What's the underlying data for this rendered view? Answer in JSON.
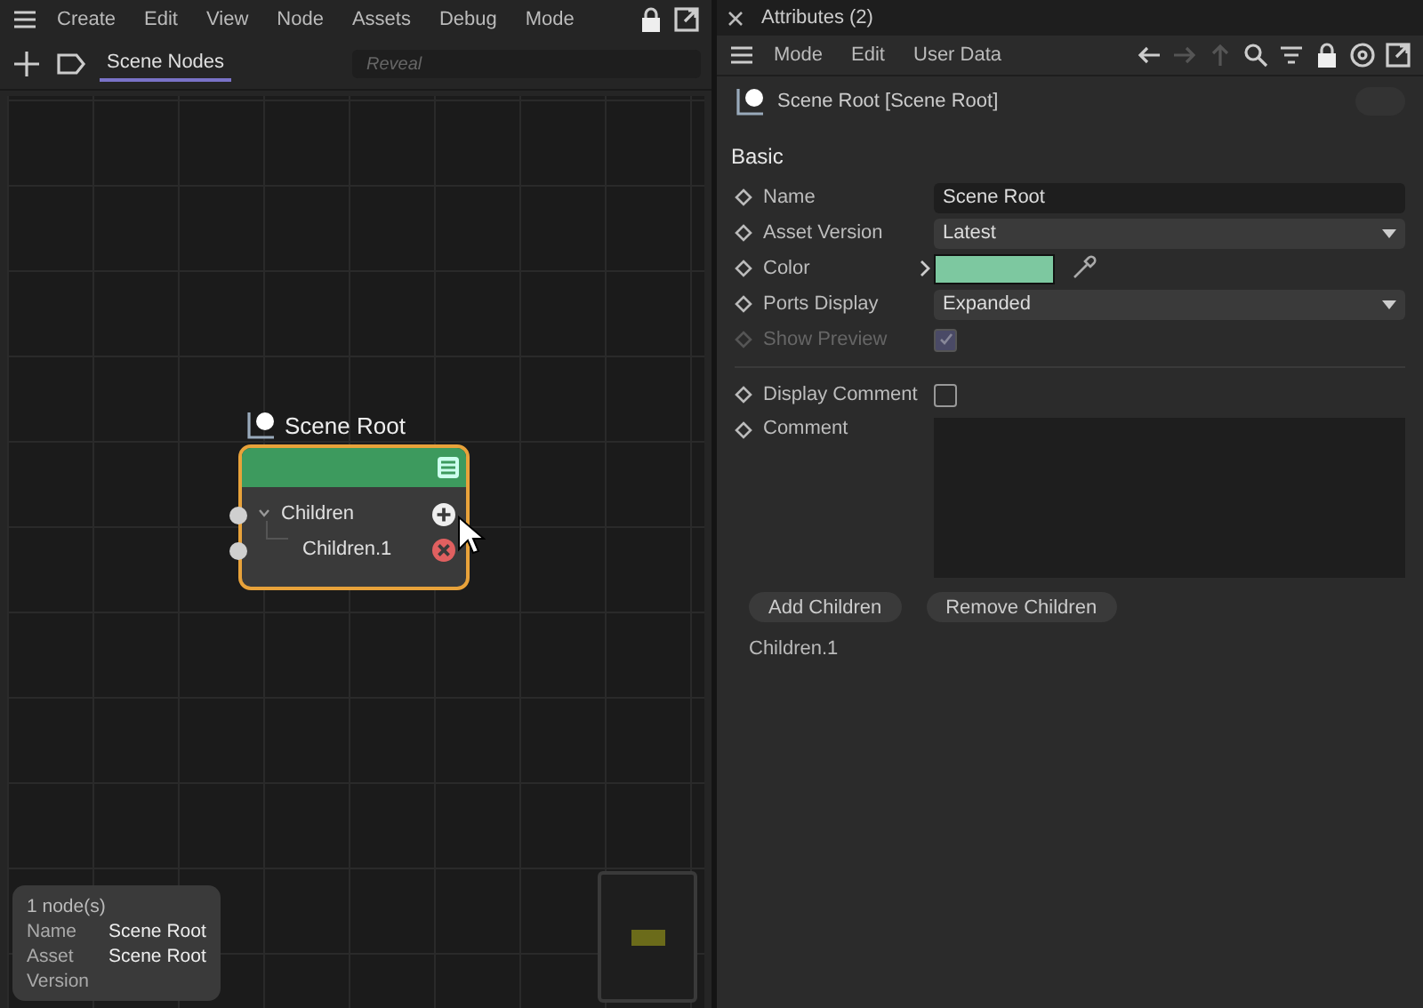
{
  "node_editor": {
    "menu": [
      "Create",
      "Edit",
      "View",
      "Node",
      "Assets",
      "Debug",
      "Mode"
    ],
    "tabs": [
      {
        "label": "Scene Nodes",
        "selected": true
      }
    ],
    "search": {
      "placeholder": "Reveal"
    },
    "node": {
      "title": "Scene Root",
      "selected": true,
      "ports": [
        {
          "label": "Children",
          "kind": "group"
        },
        {
          "label": "Children.1",
          "kind": "child"
        }
      ]
    },
    "info": {
      "count": "1 node(s)",
      "rows": [
        {
          "label": "Name",
          "value": "Scene Root"
        },
        {
          "label": "Asset Version",
          "value": "Scene Root"
        }
      ]
    }
  },
  "attributes": {
    "title": "Attributes (2)",
    "menu": [
      "Mode",
      "Edit",
      "User Data"
    ],
    "object": "Scene Root [Scene Root]",
    "object_toggle": {
      "on": false
    },
    "section": "Basic",
    "fields": [
      {
        "label": "Name",
        "kind": "text",
        "value": "Scene Root",
        "disabled": false
      },
      {
        "label": "Asset Version",
        "kind": "dropdown",
        "value": "Latest",
        "disabled": false
      },
      {
        "label": "Color",
        "kind": "color",
        "color": "#7dc8a0",
        "disabled": false
      },
      {
        "label": "Ports Display",
        "kind": "dropdown",
        "value": "Expanded",
        "disabled": false
      },
      {
        "label": "Show Preview",
        "kind": "checkbox",
        "checked": true,
        "disabled": true
      },
      {
        "label": "Display Comment",
        "kind": "checkbox",
        "checked": false,
        "disabled": false
      },
      {
        "label": "Comment",
        "kind": "textarea",
        "disabled": false
      }
    ],
    "buttons": [
      "Add Children",
      "Remove Children"
    ],
    "list": [
      "Children.1"
    ]
  }
}
